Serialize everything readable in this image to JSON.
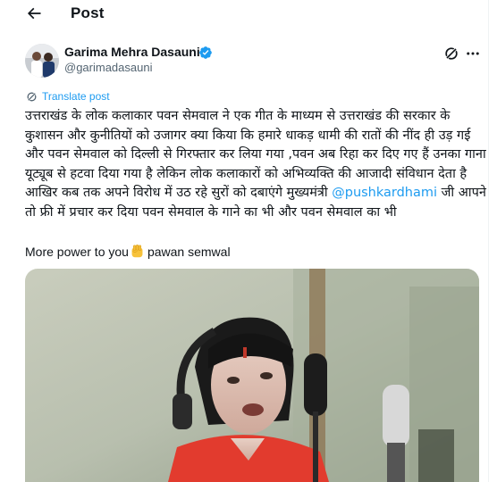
{
  "header": {
    "title": "Post"
  },
  "author": {
    "name": "Garima Mehra Dasauni",
    "handle": "@garimadasauni",
    "verified": true
  },
  "translate_label": "Translate post",
  "tweet": {
    "text_before_mention": "उत्तराखंड के लोक कलाकार पवन सेमवाल ने एक गीत के माध्यम से उत्तराखंड की सरकार के कुशासन और कुनीतियों को उजागर क्या किया कि हमारे धाकड़ धामी की रातों की नींद ही उड़ गई और पवन सेमवाल को दिल्ली से गिरफ्तार कर लिया गया ,पवन अब रिहा कर दिए गए हैं उनका गाना यूट्यूब से हटवा दिया गया है लेकिन लोक कलाकारों को अभिव्यक्ति की आजादी संविधान देता है आखिर कब तक अपने विरोध में उठ रहे सुरों को दबाएंगे मुख्यमंत्री ",
    "mention": "@pushkardhami",
    "text_after_mention": " जी आपने तो फ्री में प्रचार कर दिया पवन सेमवाल के गाने का भी और पवन सेमवाल का भी",
    "line2_before_emoji": "More power to you",
    "line2_after_emoji": " pawan semwal"
  },
  "icons": {
    "back": "arrow-left-icon",
    "verified": "verified-badge-icon",
    "grok": "grok-icon",
    "more": "more-horizontal-icon",
    "translate": "translate-icon",
    "emoji": "raised-fist-emoji"
  },
  "colors": {
    "accent": "#1d9bf0",
    "text": "#0f1419",
    "secondary": "#536471"
  }
}
